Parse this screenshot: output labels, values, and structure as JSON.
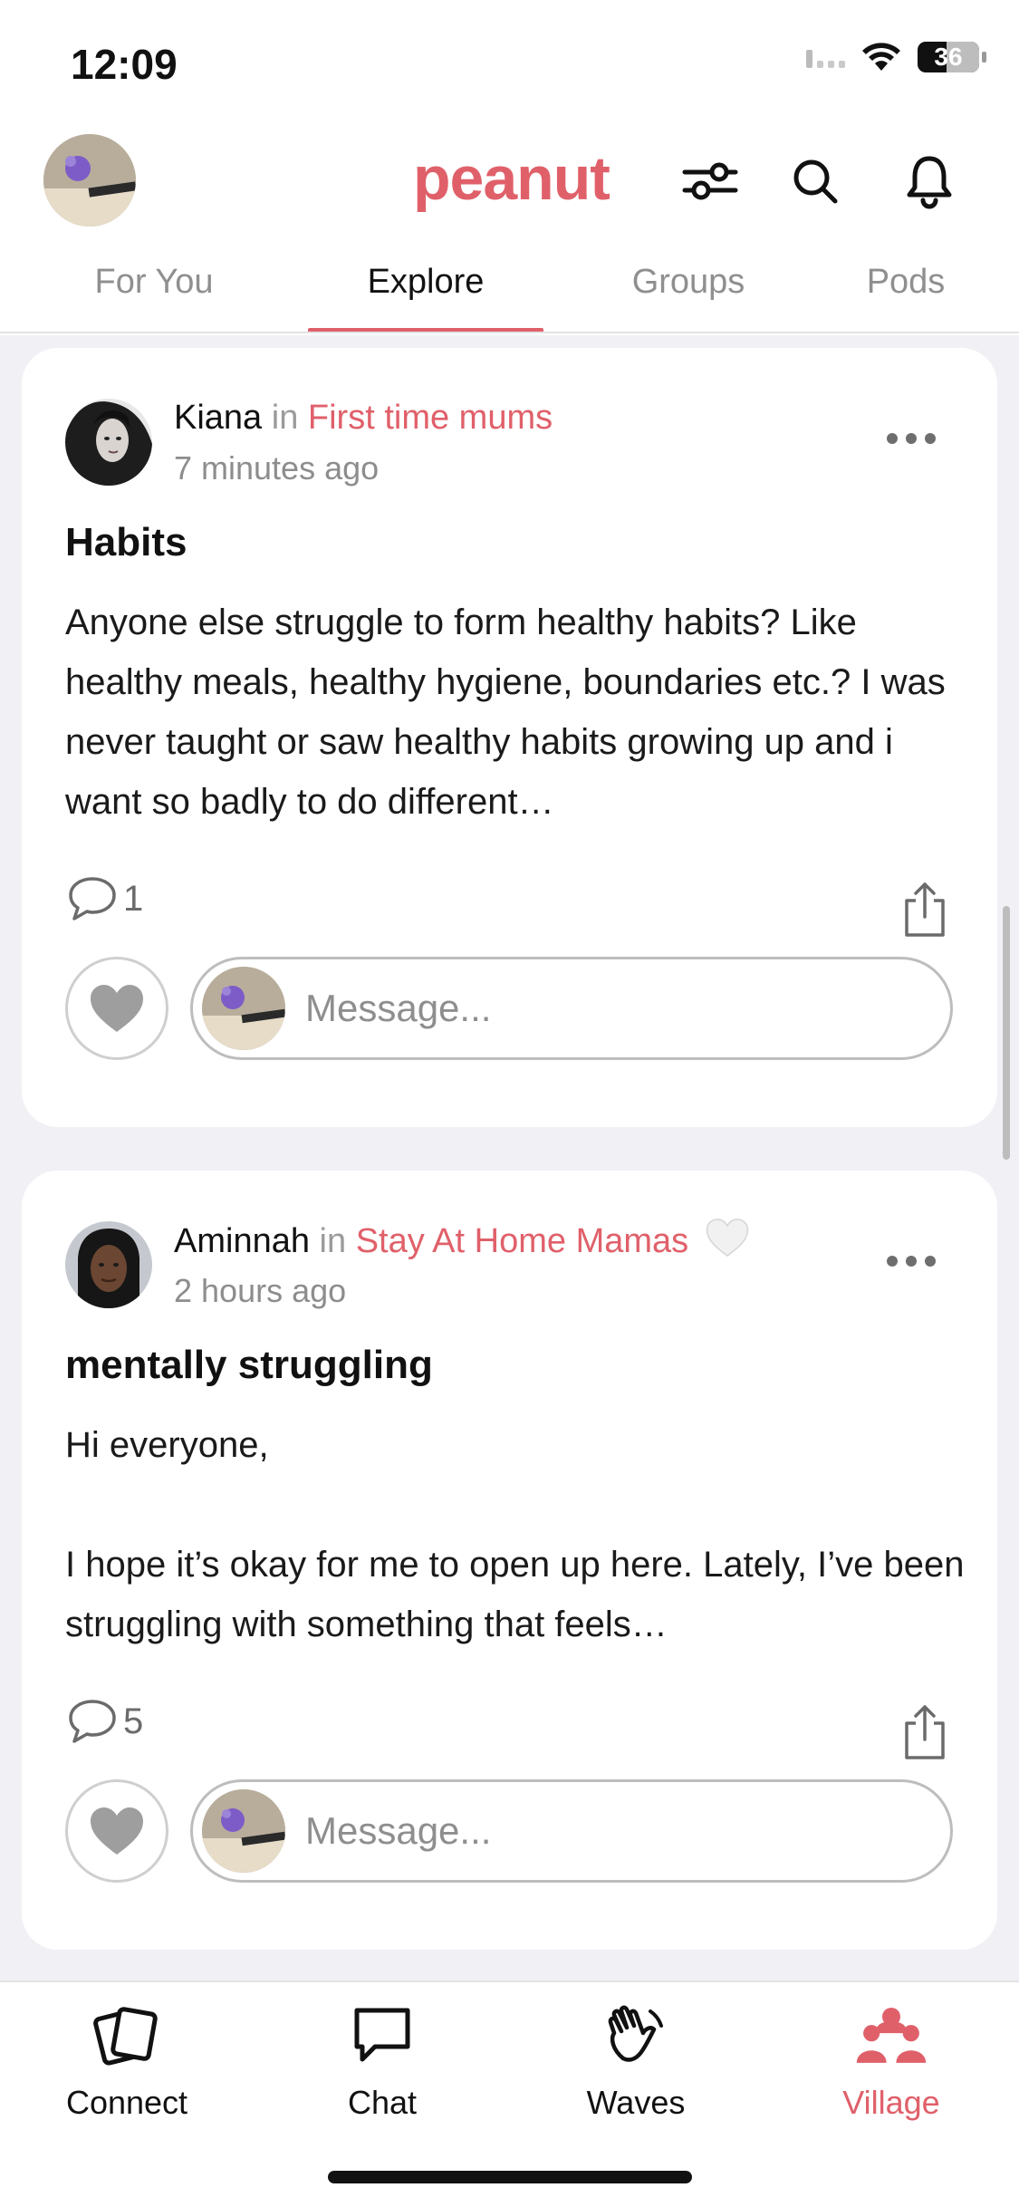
{
  "status_bar": {
    "time": "12:09",
    "battery": "36"
  },
  "header": {
    "brand": "peanut",
    "icons": [
      "filter-sliders-icon",
      "search-icon",
      "bell-icon"
    ]
  },
  "tabs": [
    {
      "label": "For You",
      "active": false
    },
    {
      "label": "Explore",
      "active": true
    },
    {
      "label": "Groups",
      "active": false
    },
    {
      "label": "Pods",
      "active": false
    }
  ],
  "posts": [
    {
      "author": "Kiana",
      "in_word": "in",
      "group": "First time mums",
      "time": "7 minutes ago",
      "title": "Habits",
      "body": "Anyone else struggle to form healthy habits? Like healthy meals, healthy hygiene, boundaries etc.? I was never taught or saw healthy habits growing up and i want so badly to do different…",
      "comments": "1",
      "message_placeholder": "Message..."
    },
    {
      "author": "Aminnah",
      "in_word": "in",
      "group": "Stay At Home Mamas",
      "time": "2 hours ago",
      "title": "mentally struggling",
      "body": "Hi everyone,\n\nI hope it’s okay for me to open up here. Lately, I’ve been struggling with something that feels…",
      "comments": "5",
      "message_placeholder": "Message..."
    }
  ],
  "bottom_nav": [
    {
      "label": "Connect",
      "icon": "cards-icon",
      "active": false
    },
    {
      "label": "Chat",
      "icon": "chat-bubble-icon",
      "active": false
    },
    {
      "label": "Waves",
      "icon": "waving-hand-icon",
      "active": false
    },
    {
      "label": "Village",
      "icon": "people-group-icon",
      "active": true
    }
  ],
  "colors": {
    "accent": "#e0606a",
    "background": "#f1f1f5",
    "card": "#ffffff"
  }
}
